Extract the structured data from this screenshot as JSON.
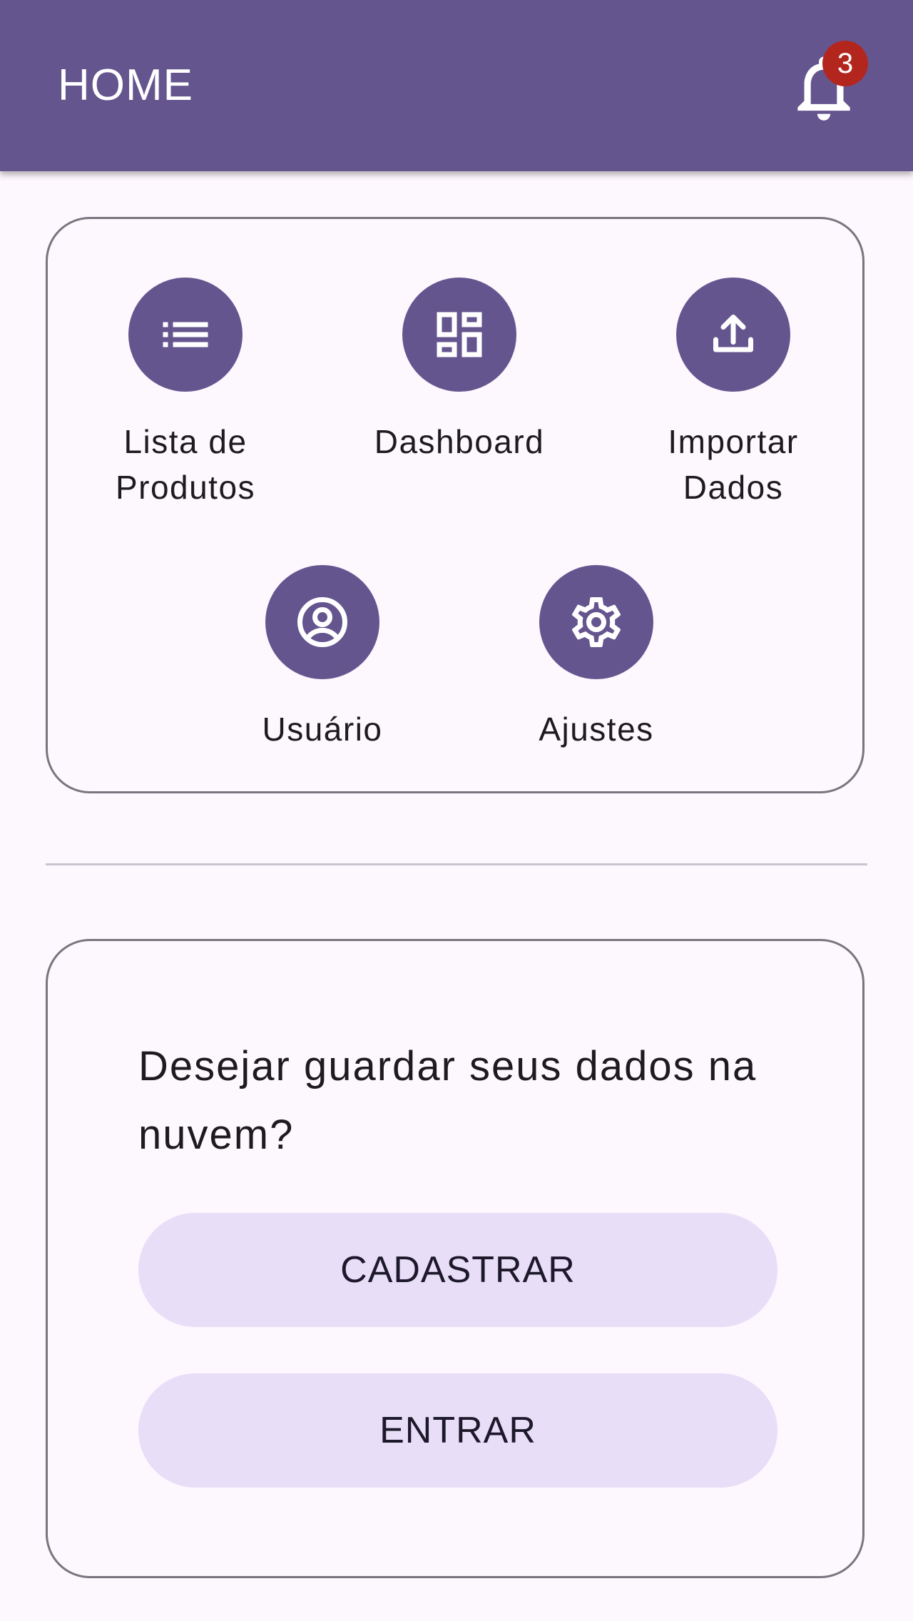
{
  "colors": {
    "primary": "#65558F",
    "background": "#FDF7FE",
    "badge": "#B3261E",
    "button_container": "#E8DEF8",
    "outline": "#79747E"
  },
  "app_bar": {
    "title": "HOME",
    "notifications": {
      "icon": "bell-icon",
      "badge_count": "3"
    }
  },
  "menu": {
    "items": [
      {
        "label": "Lista de\nProdutos",
        "icon": "list-icon"
      },
      {
        "label": "Dashboard",
        "icon": "dashboard-icon"
      },
      {
        "label": "Importar\nDados",
        "icon": "upload-icon"
      },
      {
        "label": "Usuário",
        "icon": "account-circle-icon"
      },
      {
        "label": "Ajustes",
        "icon": "gear-icon"
      }
    ]
  },
  "cloud": {
    "question": "Desejar guardar seus dados na nuvem?",
    "register_label": "CADASTRAR",
    "login_label": "ENTRAR"
  }
}
